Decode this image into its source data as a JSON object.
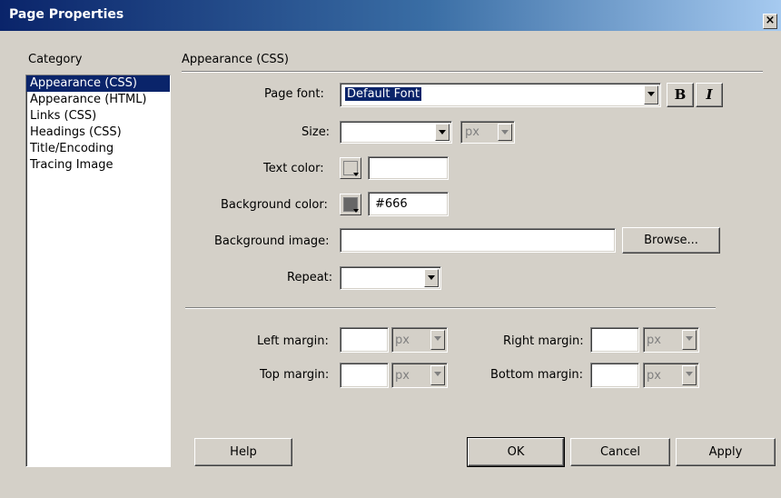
{
  "window": {
    "title": "Page Properties",
    "close_glyph": "×"
  },
  "category": {
    "label": "Category",
    "items": [
      "Appearance (CSS)",
      "Appearance (HTML)",
      "Links (CSS)",
      "Headings (CSS)",
      "Title/Encoding",
      "Tracing Image"
    ],
    "selected": "Appearance (CSS)"
  },
  "panel": {
    "title": "Appearance (CSS)"
  },
  "form": {
    "page_font_label": "Page font:",
    "page_font_value": "Default Font",
    "bold_label": "B",
    "italic_label": "I",
    "size_label": "Size:",
    "size_value": "",
    "size_unit": "px",
    "text_color_label": "Text color:",
    "text_color_value": "",
    "bg_color_label": "Background color:",
    "bg_color_value": "#666",
    "bg_color_swatch": "#666666",
    "bg_image_label": "Background image:",
    "bg_image_value": "",
    "browse_label": "Browse...",
    "repeat_label": "Repeat:",
    "repeat_value": ""
  },
  "margins": {
    "left_label": "Left margin:",
    "right_label": "Right margin:",
    "top_label": "Top margin:",
    "bottom_label": "Bottom margin:",
    "unit": "px"
  },
  "buttons": {
    "help": "Help",
    "ok": "OK",
    "cancel": "Cancel",
    "apply": "Apply"
  },
  "colors": {
    "selection": "#0a246a",
    "dialog_bg": "#d4d0c8"
  }
}
